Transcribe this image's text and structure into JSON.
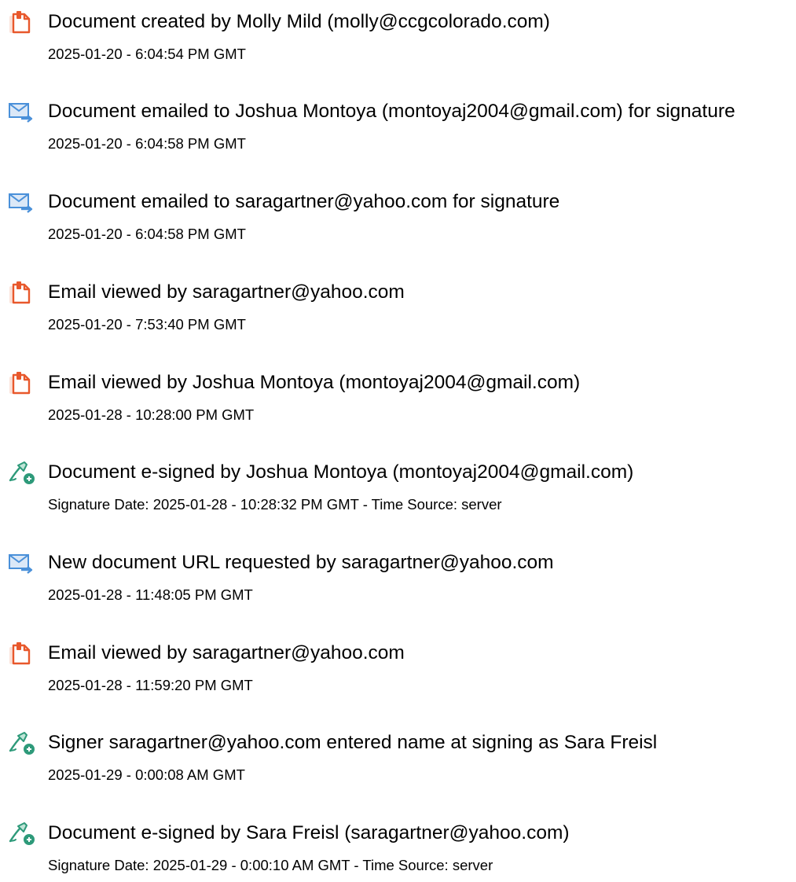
{
  "events": [
    {
      "icon": "document-icon",
      "title": "Document created by Molly Mild (molly@ccgcolorado.com)",
      "detail": "2025-01-20 - 6:04:54 PM GMT"
    },
    {
      "icon": "email-icon",
      "title": "Document emailed to Joshua Montoya (montoyaj2004@gmail.com) for signature",
      "detail": "2025-01-20 - 6:04:58 PM GMT"
    },
    {
      "icon": "email-icon",
      "title": "Document emailed to saragartner@yahoo.com for signature",
      "detail": "2025-01-20 - 6:04:58 PM GMT"
    },
    {
      "icon": "document-icon",
      "title": "Email viewed by saragartner@yahoo.com",
      "detail": "2025-01-20 - 7:53:40 PM GMT"
    },
    {
      "icon": "document-icon",
      "title": "Email viewed by Joshua Montoya (montoyaj2004@gmail.com)",
      "detail": "2025-01-28 - 10:28:00 PM GMT"
    },
    {
      "icon": "signature-pen-icon",
      "title": "Document e-signed by Joshua Montoya (montoyaj2004@gmail.com)",
      "detail": "Signature Date: 2025-01-28 - 10:28:32 PM GMT - Time Source: server"
    },
    {
      "icon": "email-icon",
      "title": "New document URL requested by saragartner@yahoo.com",
      "detail": "2025-01-28 - 11:48:05 PM GMT"
    },
    {
      "icon": "document-icon",
      "title": "Email viewed by saragartner@yahoo.com",
      "detail": "2025-01-28 - 11:59:20 PM GMT"
    },
    {
      "icon": "signature-pen-icon",
      "title": "Signer saragartner@yahoo.com entered name at signing as Sara Freisl",
      "detail": "2025-01-29 - 0:00:08 AM GMT"
    },
    {
      "icon": "signature-pen-icon",
      "title": "Document e-signed by Sara Freisl (saragartner@yahoo.com)",
      "detail": "Signature Date: 2025-01-29 - 0:00:10 AM GMT - Time Source: server"
    }
  ],
  "colors": {
    "document_icon": "#e8582c",
    "email_icon": "#4a90d9",
    "signature_icon": "#2e9a7a"
  }
}
